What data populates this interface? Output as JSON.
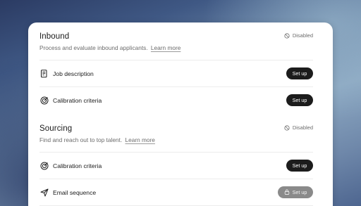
{
  "inbound": {
    "title": "Inbound",
    "description": "Process and evaluate inbound applicants.",
    "learn_more": "Learn more",
    "status": "Disabled",
    "items": [
      {
        "label": "Job description",
        "icon": "document-icon",
        "button": "Set up",
        "button_state": "enabled"
      },
      {
        "label": "Calibration criteria",
        "icon": "target-icon",
        "button": "Set up",
        "button_state": "enabled"
      }
    ]
  },
  "sourcing": {
    "title": "Sourcing",
    "description": "Find and reach out to top talent.",
    "learn_more": "Learn more",
    "status": "Disabled",
    "items": [
      {
        "label": "Calibration criteria",
        "icon": "target-icon",
        "button": "Set up",
        "button_state": "enabled"
      },
      {
        "label": "Email sequence",
        "icon": "send-icon",
        "button": "Set up",
        "button_state": "locked"
      }
    ]
  },
  "colors": {
    "button_dark": "#1c1c1c",
    "button_locked": "#8a8a8a",
    "text_primary": "#1a1a1a",
    "text_secondary": "#6b6b6b"
  }
}
